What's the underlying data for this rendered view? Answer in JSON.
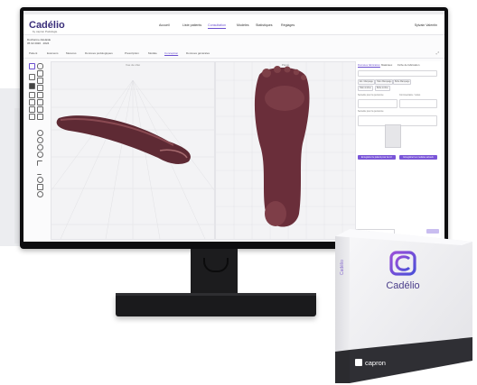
{
  "app": {
    "logo": "Cadélio",
    "logo_tagline": "by capron Podologie",
    "nav": [
      "Accueil",
      "Liste patients",
      "Consultation",
      "Modèles",
      "Statistiques",
      "Réglages"
    ],
    "nav_active_index": 2,
    "user": "Sylvain Valentin",
    "subheader": [
      "Ducharme Adelaide",
      "05 02 2020 · 2024"
    ],
    "tabs": [
      "Patient",
      "Examens",
      "Mesures",
      "Données podologiques",
      "Prescription",
      "Modèle",
      "Conception",
      "Données générales"
    ],
    "viewport_left_label": "Vue de côté",
    "viewport_right_label": "Plante",
    "side_tabs": [
      "Données fabrication",
      "Matériaux",
      "Fiche de fabrication"
    ],
    "side_chips": [
      "Ext. Marquage",
      "Talon Marquage",
      "Boîte Marquage",
      "Talon incliné",
      "Boîte incliné"
    ],
    "side_labels": [
      "Semelle pour la personne",
      "Commentaire / notes",
      "Semelle pour la personne"
    ],
    "side_buttons": [
      "Enregistrer le patient pour la réf.",
      "Enregistrer les modèles actuels"
    ],
    "bottom_placeholder": "Commentaire..."
  },
  "product_box": {
    "logo": "Cadélio",
    "brand": "capron",
    "spine_text": "Cadélio"
  },
  "colors": {
    "accent": "#6b4fcf",
    "logo_dark": "#3a2e7a",
    "foot_skin": "#6b2e3a",
    "box_base": "#f2f2f4"
  }
}
